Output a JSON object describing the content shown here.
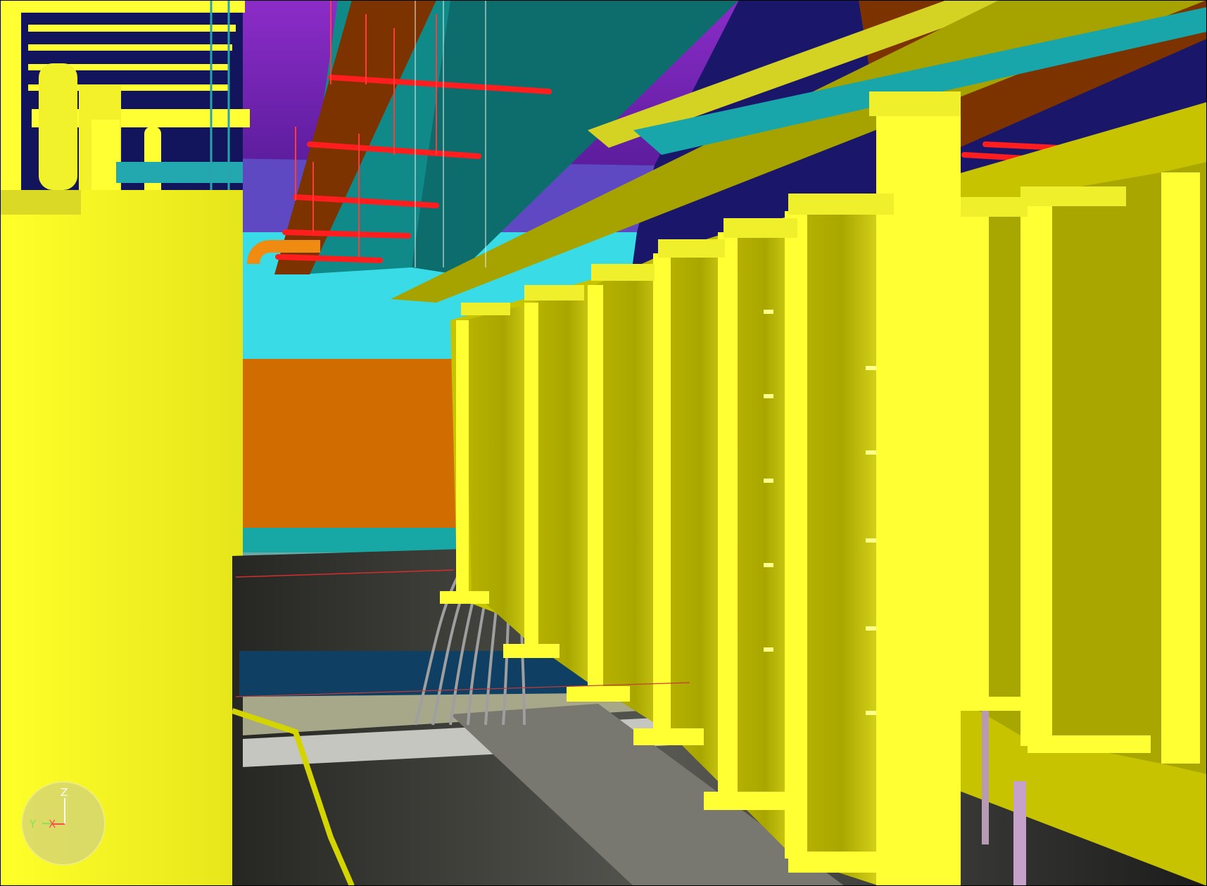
{
  "viewer": {
    "background": "#111111",
    "palette": {
      "yellow": "#ffff33",
      "yellow_dark": "#d7d41b",
      "yellow_shadow": "#9d9b00",
      "purple": "#8a25c4",
      "navy": "#18176b",
      "cyan": "#38d8e0",
      "teal": "#0f8a89",
      "red": "#ff2020",
      "orange": "#d16d00",
      "brown": "#7c3300",
      "gray": "#6f6f6a",
      "dark_gray": "#3d3d38",
      "black": "#000000"
    }
  },
  "orientation_triad": {
    "z": "Z",
    "y": "Y",
    "x": "X",
    "icon": "orientation-triad-icon"
  }
}
